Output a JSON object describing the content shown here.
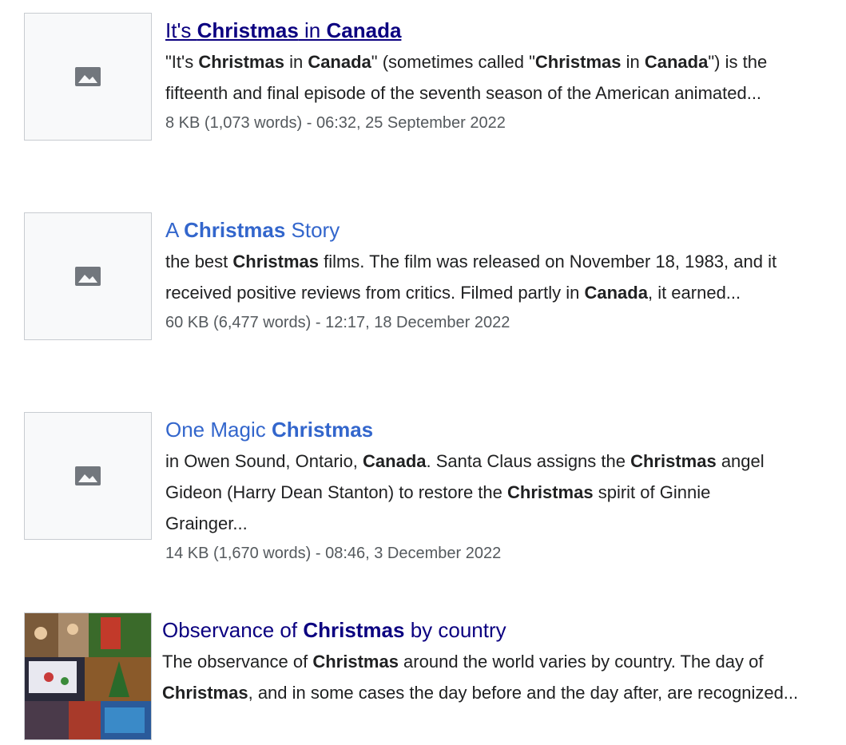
{
  "results": [
    {
      "title_parts": [
        {
          "text": "It's ",
          "bold": false
        },
        {
          "text": "Christmas",
          "bold": true
        },
        {
          "text": " in ",
          "bold": false
        },
        {
          "text": "Canada",
          "bold": true
        }
      ],
      "snippet_parts": [
        {
          "text": "\"It's ",
          "bold": false
        },
        {
          "text": "Christmas",
          "bold": true
        },
        {
          "text": " in ",
          "bold": false
        },
        {
          "text": "Canada",
          "bold": true
        },
        {
          "text": "\" (sometimes called \"",
          "bold": false
        },
        {
          "text": "Christmas",
          "bold": true
        },
        {
          "text": " in ",
          "bold": false
        },
        {
          "text": "Canada",
          "bold": true
        },
        {
          "text": "\") is the fifteenth and final episode of the seventh season of the American animated...",
          "bold": false
        }
      ],
      "meta": "8 KB (1,073 words) - 06:32, 25 September 2022",
      "thumbnail": "image-placeholder-icon",
      "visited": true,
      "hovered": true
    },
    {
      "title_parts": [
        {
          "text": "A ",
          "bold": false
        },
        {
          "text": "Christmas",
          "bold": true
        },
        {
          "text": " Story",
          "bold": false
        }
      ],
      "snippet_parts": [
        {
          "text": "the best ",
          "bold": false
        },
        {
          "text": "Christmas",
          "bold": true
        },
        {
          "text": " films. The film was released on November 18, 1983, and it received positive reviews from critics. Filmed partly in ",
          "bold": false
        },
        {
          "text": "Canada",
          "bold": true
        },
        {
          "text": ", it earned...",
          "bold": false
        }
      ],
      "meta": "60 KB (6,477 words) - 12:17, 18 December 2022",
      "thumbnail": "image-placeholder-icon",
      "visited": false,
      "hovered": false
    },
    {
      "title_parts": [
        {
          "text": "One Magic ",
          "bold": false
        },
        {
          "text": "Christmas",
          "bold": true
        }
      ],
      "snippet_parts": [
        {
          "text": "in Owen Sound, Ontario, ",
          "bold": false
        },
        {
          "text": "Canada",
          "bold": true
        },
        {
          "text": ". Santa Claus assigns the ",
          "bold": false
        },
        {
          "text": "Christmas",
          "bold": true
        },
        {
          "text": " angel Gideon (Harry Dean Stanton) to restore the ",
          "bold": false
        },
        {
          "text": "Christmas",
          "bold": true
        },
        {
          "text": " spirit of Ginnie Grainger...",
          "bold": false
        }
      ],
      "meta": "14 KB (1,670 words) - 08:46, 3 December 2022",
      "thumbnail": "image-placeholder-icon",
      "visited": false,
      "hovered": false
    },
    {
      "title_parts": [
        {
          "text": "Observance of ",
          "bold": false
        },
        {
          "text": "Christmas",
          "bold": true
        },
        {
          "text": " by country",
          "bold": false
        }
      ],
      "snippet_parts": [
        {
          "text": "The observance of ",
          "bold": false
        },
        {
          "text": "Christmas",
          "bold": true
        },
        {
          "text": " around the world varies by country. The day of ",
          "bold": false
        },
        {
          "text": "Christmas",
          "bold": true
        },
        {
          "text": ", and in some cases the day before and the day after, are recognized...",
          "bold": false
        }
      ],
      "meta": "",
      "thumbnail": "christmas-collage-photo",
      "visited": true,
      "hovered": false
    }
  ],
  "colors": {
    "link": "#3366cc",
    "visited_link": "#0b0080",
    "text": "#202122",
    "meta": "#54595d",
    "placeholder_bg": "#f8f9fa",
    "placeholder_icon": "#72777d"
  }
}
